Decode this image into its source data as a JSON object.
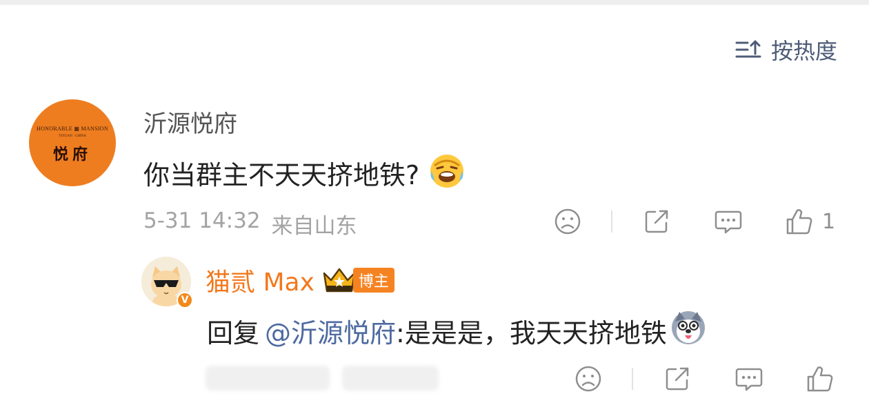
{
  "sort": {
    "label": "按热度",
    "icon": "sort-icon"
  },
  "comment": {
    "username": "沂源悦府",
    "avatar": {
      "brand_top": "HONORABLE ▦ MANSION",
      "brand_sub": "YIYUAN · CHINA",
      "brand_cn": "悦府"
    },
    "text": "你当群主不天天挤地铁?",
    "emoji": "laughing-crying-emoji",
    "time": "5-31 14:32",
    "location": "来自山东",
    "like_count": "1"
  },
  "reply": {
    "username": "猫贰 Max",
    "badge": "博主",
    "verified": "V",
    "prefix": "回复",
    "mention": "@沂源悦府",
    "text": ":是是是，我天天挤地铁",
    "emoji": "husky-emoji"
  },
  "colors": {
    "accent_orange": "#f2781d",
    "mention_blue": "#4e6aa0",
    "icon_gray": "#8e8e8e",
    "meta_gray": "#a3a3a3",
    "sort_blue": "#4e5b77"
  }
}
